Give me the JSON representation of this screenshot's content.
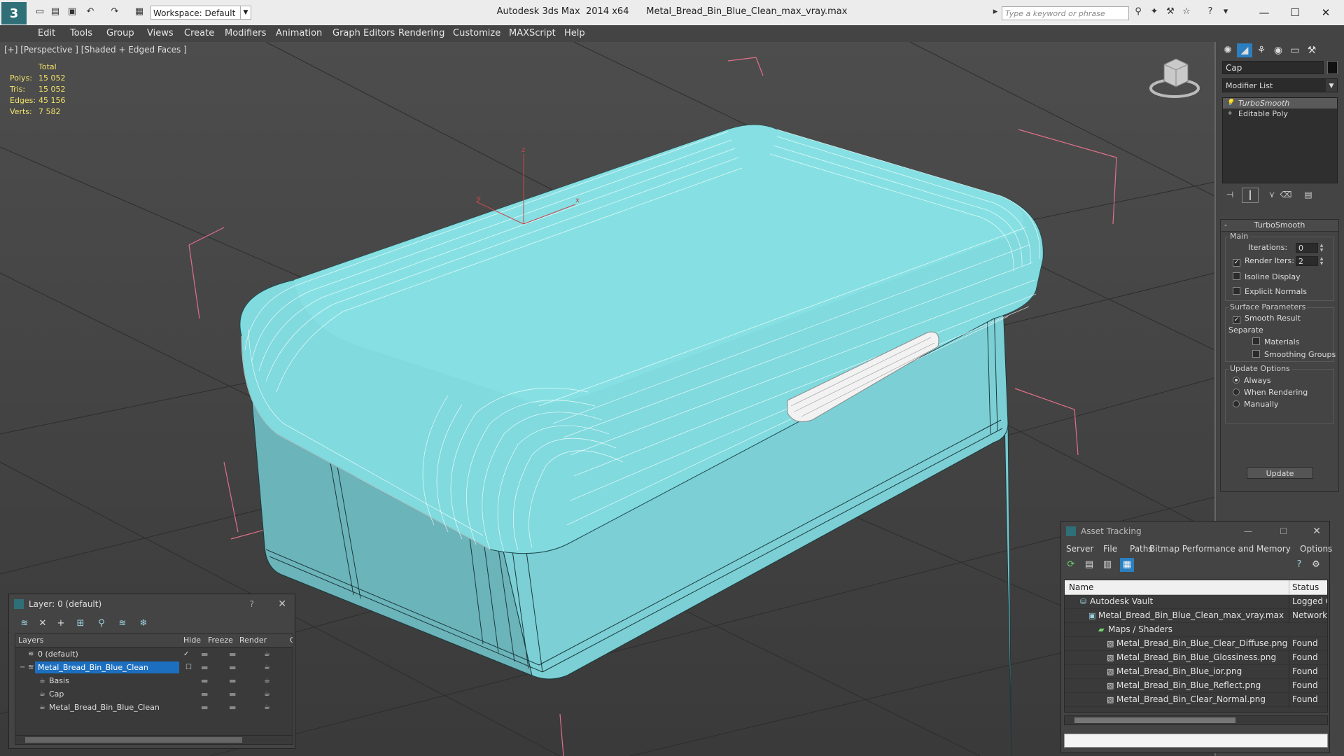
{
  "titlebar": {
    "app": "Autodesk 3ds Max  2014 x64",
    "file": "Metal_Bread_Bin_Blue_Clean_max_vray.max",
    "workspace": "Workspace: Default",
    "search_placeholder": "Type a keyword or phrase"
  },
  "menu": [
    "Edit",
    "Tools",
    "Group",
    "Views",
    "Create",
    "Modifiers",
    "Animation",
    "Graph Editors",
    "Rendering",
    "Customize",
    "MAXScript",
    "Help"
  ],
  "viewport": {
    "label": "[+] [Perspective ] [Shaded + Edged Faces ]",
    "stats": {
      "header": "Total",
      "rows": [
        {
          "label": "Polys:",
          "value": "15 052"
        },
        {
          "label": "Tris:",
          "value": "15 052"
        },
        {
          "label": "Edges:",
          "value": "45 156"
        },
        {
          "label": "Verts:",
          "value": "7 582"
        }
      ]
    },
    "axes": {
      "x": "x",
      "y": "y",
      "z": "z"
    }
  },
  "command_panel": {
    "object_name": "Cap",
    "modifier_list": "Modifier List",
    "stack": [
      "TurboSmooth",
      "Editable Poly"
    ],
    "rollout_title": "TurboSmooth",
    "main_group": "Main",
    "iterations_label": "Iterations:",
    "iterations_value": "0",
    "render_iters_label": "Render Iters:",
    "render_iters_value": "2",
    "isoline_display": "Isoline Display",
    "explicit_normals": "Explicit Normals",
    "surface_group": "Surface Parameters",
    "smooth_result": "Smooth Result",
    "separate_label": "Separate",
    "materials": "Materials",
    "smoothing_groups": "Smoothing Groups",
    "update_group": "Update Options",
    "always": "Always",
    "when_rendering": "When Rendering",
    "manually": "Manually",
    "update_button": "Update"
  },
  "layer_window": {
    "title": "Layer: 0 (default)",
    "help": "?",
    "columns": {
      "layers": "Layers",
      "hide": "Hide",
      "freeze": "Freeze",
      "render": "Render",
      "extra": "C"
    },
    "rows": [
      {
        "name": "0 (default)"
      },
      {
        "name": "Metal_Bread_Bin_Blue_Clean"
      },
      {
        "name": "Basis"
      },
      {
        "name": "Cap"
      },
      {
        "name": "Metal_Bread_Bin_Blue_Clean"
      }
    ]
  },
  "asset_window": {
    "title": "Asset Tracking",
    "menu": [
      "Server",
      "File",
      "Paths",
      "Bitmap Performance and Memory",
      "Options"
    ],
    "columns": {
      "name": "Name",
      "status": "Status"
    },
    "rows": [
      {
        "name": "Autodesk Vault",
        "status": "Logged O"
      },
      {
        "name": "Metal_Bread_Bin_Blue_Clean_max_vray.max",
        "status": "Network P"
      },
      {
        "name": "Maps / Shaders",
        "status": ""
      },
      {
        "name": "Metal_Bread_Bin_Blue_Clear_Diffuse.png",
        "status": "Found"
      },
      {
        "name": "Metal_Bread_Bin_Blue_Glossiness.png",
        "status": "Found"
      },
      {
        "name": "Metal_Bread_Bin_Blue_ior.png",
        "status": "Found"
      },
      {
        "name": "Metal_Bread_Bin_Blue_Reflect.png",
        "status": "Found"
      },
      {
        "name": "Metal_Bread_Bin_Clear_Normal.png",
        "status": "Found"
      }
    ]
  },
  "colors": {
    "object": "#7fd8de",
    "selection": "#1c6fbf",
    "stats": "#f3e36a"
  }
}
